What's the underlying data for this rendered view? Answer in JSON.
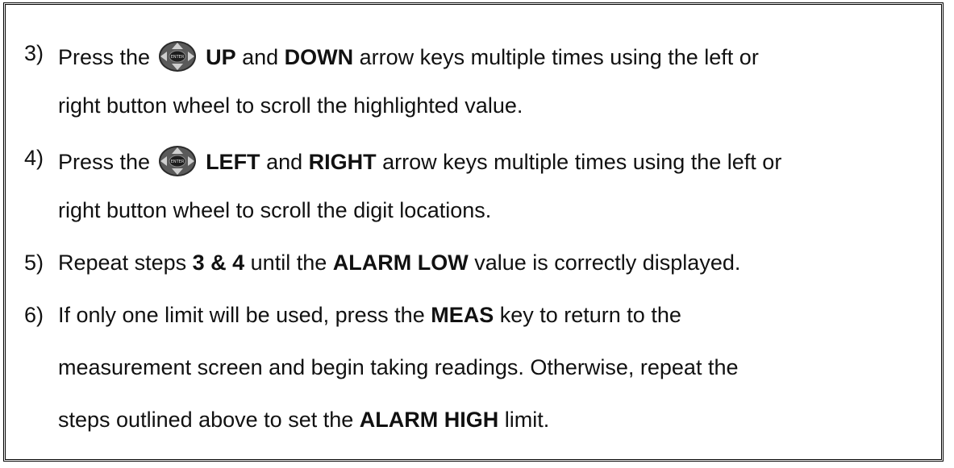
{
  "steps": [
    {
      "number": "3)",
      "line1": [
        {
          "text": "Press the ",
          "bold": false
        },
        {
          "icon": "enter-dpad-icon"
        },
        {
          "text": " UP",
          "bold": true
        },
        {
          "text": " and ",
          "bold": false
        },
        {
          "text": "DOWN",
          "bold": true
        },
        {
          "text": " arrow keys multiple times using the left or",
          "bold": false
        }
      ],
      "line2": [
        {
          "text": "right button wheel to scroll the highlighted value.",
          "bold": false
        }
      ]
    },
    {
      "number": "4)",
      "line1": [
        {
          "text": "Press the ",
          "bold": false
        },
        {
          "icon": "enter-dpad-icon"
        },
        {
          "text": " LEFT",
          "bold": true
        },
        {
          "text": " and ",
          "bold": false
        },
        {
          "text": "RIGHT",
          "bold": true
        },
        {
          "text": " arrow keys multiple times using the left or",
          "bold": false
        }
      ],
      "line2": [
        {
          "text": "right button wheel to scroll the digit locations.",
          "bold": false
        }
      ]
    },
    {
      "number": "5)",
      "line1": [
        {
          "text": " Repeat steps ",
          "bold": false
        },
        {
          "text": "3 & 4",
          "bold": true
        },
        {
          "text": " until the ",
          "bold": false
        },
        {
          "text": "ALARM LOW",
          "bold": true
        },
        {
          "text": " value is correctly displayed.",
          "bold": false
        }
      ]
    },
    {
      "number": "6)",
      "line1": [
        {
          "text": "If only one limit will be used, press the ",
          "bold": false
        },
        {
          "text": "MEAS",
          "bold": true
        },
        {
          "text": " key to return to the",
          "bold": false
        }
      ],
      "line2": [
        {
          "text": "measurement screen and begin taking readings.  Otherwise, repeat the",
          "bold": false
        }
      ],
      "line3": [
        {
          "text": "steps outlined above to set the ",
          "bold": false
        },
        {
          "text": "ALARM HIGH",
          "bold": true
        },
        {
          "text": " limit.",
          "bold": false
        }
      ]
    }
  ],
  "icon_label": "ENTER"
}
